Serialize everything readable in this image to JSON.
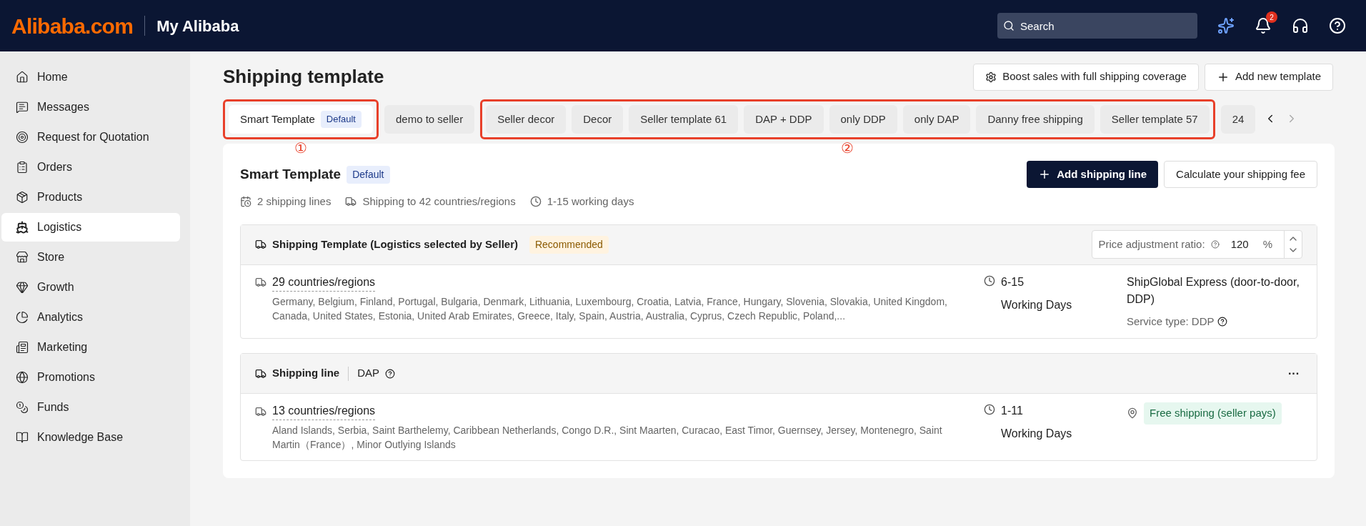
{
  "header": {
    "logo": "Alibaba.com",
    "title": "My Alibaba",
    "search": {
      "placeholder": "Search"
    },
    "notifications": "2"
  },
  "sidebar": {
    "items": [
      {
        "label": "Home",
        "selected": false
      },
      {
        "label": "Messages",
        "selected": false
      },
      {
        "label": "Request for Quotation",
        "selected": false
      },
      {
        "label": "Orders",
        "selected": false
      },
      {
        "label": "Products",
        "selected": false
      },
      {
        "label": "Logistics",
        "selected": true
      },
      {
        "label": "Store",
        "selected": false
      },
      {
        "label": "Growth",
        "selected": false
      },
      {
        "label": "Analytics",
        "selected": false
      },
      {
        "label": "Marketing",
        "selected": false
      },
      {
        "label": "Promotions",
        "selected": false
      },
      {
        "label": "Funds",
        "selected": false
      },
      {
        "label": "Knowledge Base",
        "selected": false
      }
    ]
  },
  "page": {
    "title": "Shipping template",
    "buttons": [
      "Boost sales with full shipping coverage",
      "Add new template"
    ]
  },
  "tab_groups": [
    {
      "annotation": "①",
      "tabs": [
        {
          "label": "Smart Template",
          "badge": "Default",
          "selected": true
        }
      ]
    },
    {
      "tabs": [
        {
          "label": "demo to seller",
          "selected": false
        }
      ]
    },
    {
      "annotation": "②",
      "tabs": [
        {
          "label": "Seller decor",
          "selected": false
        },
        {
          "label": "Decor",
          "selected": false
        },
        {
          "label": "Seller template 61",
          "selected": false
        },
        {
          "label": "DAP + DDP",
          "selected": false
        },
        {
          "label": "only DDP",
          "selected": false
        },
        {
          "label": "only DAP",
          "selected": false
        },
        {
          "label": "Danny free shipping",
          "selected": false
        },
        {
          "label": "Seller template 57",
          "selected": false
        }
      ]
    },
    {
      "tabs": [
        {
          "label": "24",
          "selected": false
        }
      ]
    }
  ],
  "template": {
    "title": "Smart Template",
    "badge": "Default",
    "buttons": [
      "Add shipping line",
      "Calculate your shipping fee"
    ],
    "stats": [
      "2 shipping lines",
      "Shipping to 42 countries/regions",
      "1-15 working days"
    ],
    "sections": [
      {
        "kind": "template",
        "title": "Shipping Template (Logistics selected by Seller)",
        "tag": "Recommended",
        "ratio_label": "Price adjustment ratio:",
        "ratio_value": "120",
        "ratio_unit": "%",
        "countries": "29 countries/regions",
        "country_list": "Germany, Belgium, Finland, Portugal, Bulgaria, Denmark, Lithuania, Luxembourg, Croatia, Latvia, France, Hungary, Slovenia, Slovakia, United Kingdom, Canada, United States, Estonia, United Arab Emirates, Greece, Italy, Spain, Austria, Australia, Cyprus, Czech Republic, Poland,...",
        "days": "6-15",
        "days_label": "Working Days",
        "service": "ShipGlobal Express (door-to-door, DDP)",
        "service_type": "Service type: DDP"
      },
      {
        "kind": "line",
        "title": "Shipping line",
        "tag": "DAP",
        "more": "···",
        "countries": "13 countries/regions",
        "country_list": "Aland Islands, Serbia, Saint Barthelemy, Caribbean Netherlands, Congo D.R., Sint Maarten, Curacao, East Timor, Guernsey, Jersey, Montenegro, Saint Martin（France）, Minor Outlying Islands",
        "days": "1-11",
        "days_label": "Working Days",
        "free": "Free shipping (seller pays)"
      }
    ]
  }
}
